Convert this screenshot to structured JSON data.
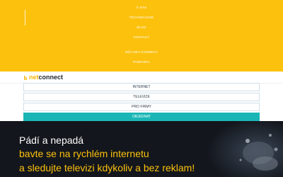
{
  "top_menu": {
    "items": [
      "O NÁS",
      "TECHNOLOGIE",
      "BLOG",
      "KONTAKT"
    ],
    "secondary": [
      "MŮJ NET-CONNECT",
      "PODPORA"
    ]
  },
  "logo": {
    "part1": "net",
    "part2": "connect"
  },
  "sub_nav": {
    "items": [
      "INTERNET",
      "TELEVIZE",
      "PRO FIRMY",
      "OBJEDNAT"
    ]
  },
  "hero": {
    "title": "Pádí a nepadá",
    "line1": "bavte se na rychlém internetu",
    "line2": "a sledujte televizi kdykoliv a bez reklam!"
  },
  "colors": {
    "yellow": "#fcc10d",
    "teal": "#1ab6b6",
    "dark": "#13161c"
  }
}
